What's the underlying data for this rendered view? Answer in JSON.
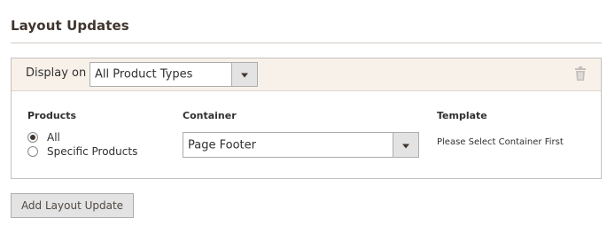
{
  "section": {
    "title": "Layout Updates"
  },
  "update": {
    "display_on_label": "Display on",
    "display_on_value": "All Product Types",
    "products": {
      "heading": "Products",
      "options": [
        {
          "label": "All",
          "checked": true
        },
        {
          "label": "Specific Products",
          "checked": false
        }
      ]
    },
    "container": {
      "heading": "Container",
      "value": "Page Footer"
    },
    "template": {
      "heading": "Template",
      "value": "Please Select Container First"
    },
    "delete_icon": "trash-icon"
  },
  "actions": {
    "add_label": "Add Layout Update"
  },
  "colors": {
    "header_bg": "#f8f1ea",
    "border": "#c7c1bc",
    "button_bg": "#e3e3e3",
    "text": "#303030"
  }
}
